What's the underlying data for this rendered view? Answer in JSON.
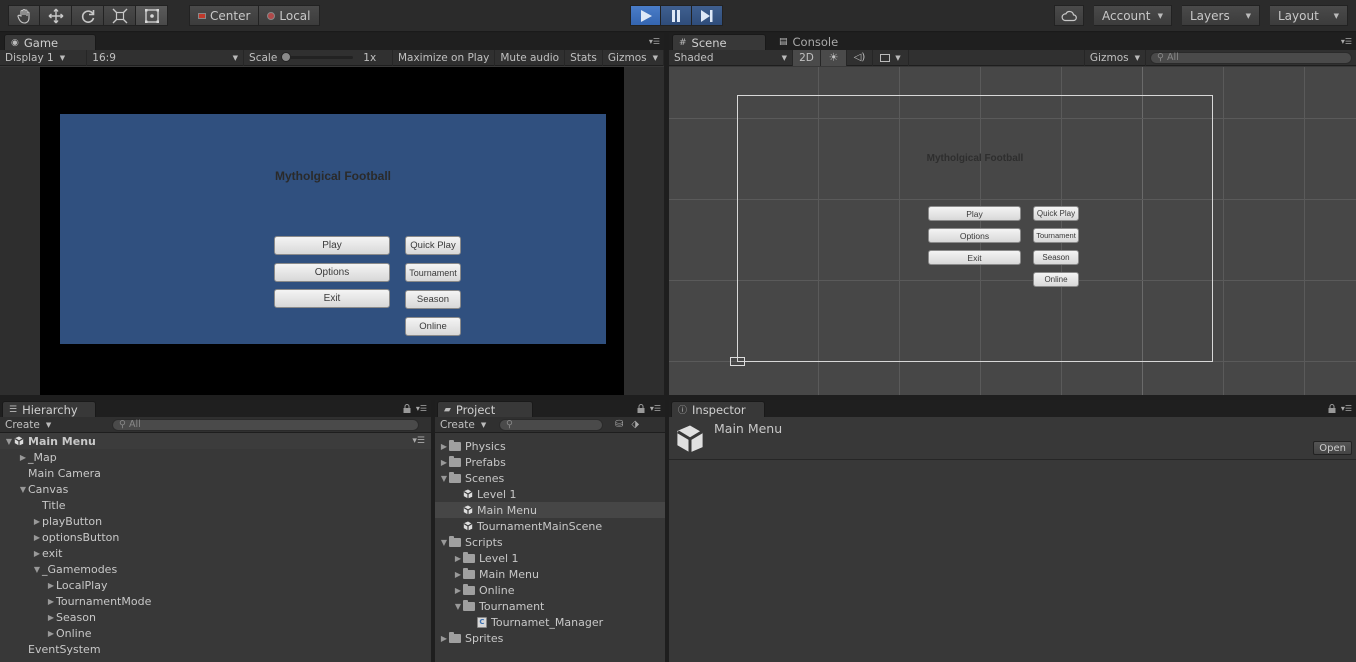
{
  "toolbar": {
    "transform_tools": [
      "hand-tool",
      "move-tool",
      "rotate-tool",
      "scale-tool",
      "rect-tool"
    ],
    "pivot": "Center",
    "space": "Local",
    "account": "Account",
    "layers": "Layers",
    "layout": "Layout"
  },
  "game": {
    "tab": "Game",
    "display": "Display 1",
    "aspect": "16:9",
    "scale_label": "Scale",
    "scale_value": "1x",
    "maximize": "Maximize on Play",
    "mute": "Mute audio",
    "stats": "Stats",
    "gizmos": "Gizmos"
  },
  "menu_ui": {
    "title": "Mytholgical Football",
    "buttons": [
      "Play",
      "Options",
      "Exit"
    ],
    "modes": [
      "Quick Play",
      "Tournament",
      "Season",
      "Online"
    ]
  },
  "scene": {
    "tab": "Scene",
    "console_tab": "Console",
    "shading": "Shaded",
    "mode_2d": "2D",
    "gizmos": "Gizmos",
    "search_placeholder": "All"
  },
  "hierarchy": {
    "tab": "Hierarchy",
    "create": "Create",
    "search_placeholder": "All",
    "scene_name": "Main Menu",
    "items": [
      {
        "label": "_Map",
        "depth": 1,
        "arrow": "right"
      },
      {
        "label": "Main Camera",
        "depth": 1,
        "arrow": ""
      },
      {
        "label": "Canvas",
        "depth": 1,
        "arrow": "down"
      },
      {
        "label": "Title",
        "depth": 2,
        "arrow": ""
      },
      {
        "label": "playButton",
        "depth": 2,
        "arrow": "right"
      },
      {
        "label": "optionsButton",
        "depth": 2,
        "arrow": "right"
      },
      {
        "label": "exit",
        "depth": 2,
        "arrow": "right"
      },
      {
        "label": "_Gamemodes",
        "depth": 2,
        "arrow": "down"
      },
      {
        "label": "LocalPlay",
        "depth": 3,
        "arrow": "right"
      },
      {
        "label": "TournamentMode",
        "depth": 3,
        "arrow": "right"
      },
      {
        "label": "Season",
        "depth": 3,
        "arrow": "right"
      },
      {
        "label": "Online",
        "depth": 3,
        "arrow": "right"
      },
      {
        "label": "EventSystem",
        "depth": 1,
        "arrow": ""
      }
    ]
  },
  "project": {
    "tab": "Project",
    "create": "Create",
    "items": [
      {
        "label": "Physics",
        "depth": 0,
        "arrow": "right",
        "icon": "folder"
      },
      {
        "label": "Prefabs",
        "depth": 0,
        "arrow": "right",
        "icon": "folder"
      },
      {
        "label": "Scenes",
        "depth": 0,
        "arrow": "down",
        "icon": "folder"
      },
      {
        "label": "Level 1",
        "depth": 1,
        "arrow": "",
        "icon": "unity"
      },
      {
        "label": "Main Menu",
        "depth": 1,
        "arrow": "",
        "icon": "unity",
        "selected": true
      },
      {
        "label": "TournamentMainScene",
        "depth": 1,
        "arrow": "",
        "icon": "unity"
      },
      {
        "label": "Scripts",
        "depth": 0,
        "arrow": "down",
        "icon": "folder"
      },
      {
        "label": "Level 1",
        "depth": 1,
        "arrow": "right",
        "icon": "folder"
      },
      {
        "label": "Main Menu",
        "depth": 1,
        "arrow": "right",
        "icon": "folder"
      },
      {
        "label": "Online",
        "depth": 1,
        "arrow": "right",
        "icon": "folder"
      },
      {
        "label": "Tournament",
        "depth": 1,
        "arrow": "down",
        "icon": "folder"
      },
      {
        "label": "Tournamet_Manager",
        "depth": 2,
        "arrow": "",
        "icon": "script"
      },
      {
        "label": "Sprites",
        "depth": 0,
        "arrow": "right",
        "icon": "folder"
      }
    ]
  },
  "inspector": {
    "tab": "Inspector",
    "asset_name": "Main Menu",
    "open": "Open"
  }
}
